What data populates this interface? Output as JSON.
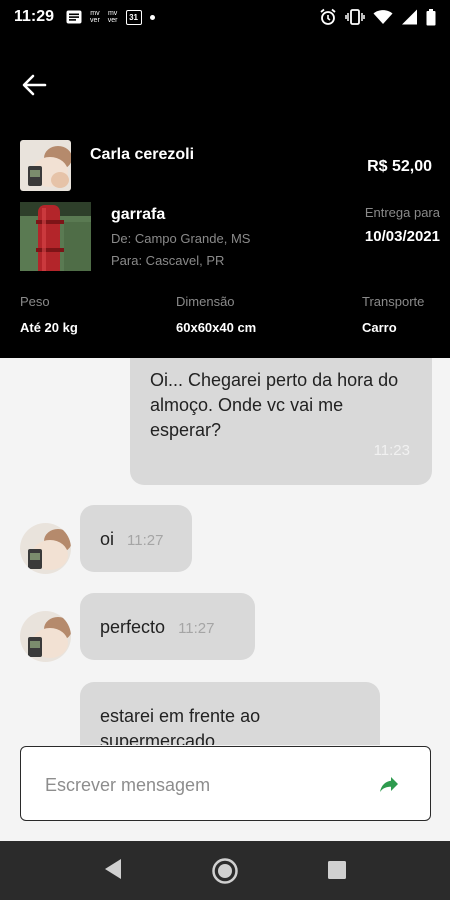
{
  "status_bar": {
    "time": "11:29",
    "badge1": "mv\nver",
    "badge2": "mv\nver",
    "calendar": "31"
  },
  "header": {
    "user_name": "Carla  cerezoli",
    "price": "R$ 52,00",
    "product_name": "garrafa",
    "from": "De: Campo Grande, MS",
    "to": "Para: Cascavel, PR",
    "deliver_label": "Entrega para",
    "deliver_date": "10/03/2021",
    "weight_label": "Peso",
    "weight_value": "Até 20 kg",
    "dimension_label": "Dimensão",
    "dimension_value": "60x60x40 cm",
    "transport_label": "Transporte",
    "transport_value": "Carro"
  },
  "messages": [
    {
      "side": "sent",
      "text": "Oi... Chegarei perto da hora do almoço. Onde vc vai me esperar?",
      "time": "11:23"
    },
    {
      "side": "received",
      "text": "oi",
      "time": "11:27"
    },
    {
      "side": "received",
      "text": "perfecto",
      "time": "11:27"
    },
    {
      "side": "received",
      "text": "estarei em frente ao supermercado",
      "time": ""
    }
  ],
  "composer": {
    "placeholder": "Escrever mensagem"
  },
  "colors": {
    "header_bg": "#000000",
    "bubble_bg": "#d9d9d9",
    "send_accent": "#2e9b4e",
    "nav_bg": "#2b2b2b"
  }
}
